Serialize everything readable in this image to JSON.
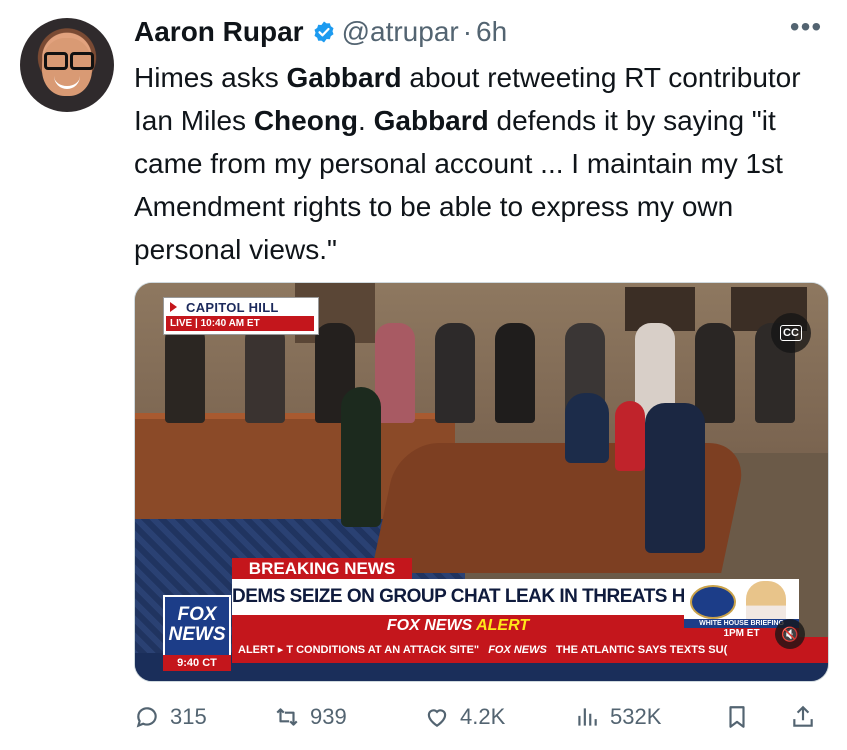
{
  "author": {
    "name": "Aaron Rupar",
    "handle": "@atrupar",
    "separator": "·",
    "time": "6h",
    "verified": true
  },
  "menu_icon": "more-dots-icon",
  "tweet": {
    "parts": [
      {
        "text": "Himes asks ",
        "bold": false
      },
      {
        "text": "Gabbard",
        "bold": true
      },
      {
        "text": " about retweeting RT contributor Ian Miles ",
        "bold": false
      },
      {
        "text": "Cheong",
        "bold": true
      },
      {
        "text": ". ",
        "bold": false
      },
      {
        "text": "Gabbard",
        "bold": true
      },
      {
        "text": " defends it by saying \"it came from my personal account ... I maintain my 1st Amendment rights to be able to express my own personal views.\"",
        "bold": false
      }
    ]
  },
  "video": {
    "location_title": "CAPITOL HILL",
    "live_text": "LIVE | 10:40 AM ET",
    "cc_label": "CC",
    "breaking_label": "BREAKING NEWS",
    "headline": "DEMS SEIZE ON GROUP CHAT LEAK IN THREATS HEARING",
    "alert_brand": "FOX NEWS",
    "alert_word": "ALERT",
    "ticker_prefix": "ALERT",
    "ticker_text": "T CONDITIONS AT AN ATTACK SITE\"",
    "ticker_brand": "FOX NEWS",
    "ticker_text2": "THE ATLANTIC SAYS TEXTS SU(",
    "network_logo_line1": "FOX",
    "network_logo_line2": "NEWS",
    "network_time": "9:40 CT",
    "inset_label": "WHITE HOUSE BRIEFING",
    "inset_time": "1PM ET",
    "mute_icon": "speaker-muted-icon"
  },
  "actions": {
    "replies": "315",
    "reposts": "939",
    "likes": "4.2K",
    "views": "532K"
  },
  "colors": {
    "text": "#0f1419",
    "muted": "#536471",
    "verified": "#1d9bf0",
    "fox_red": "#c4161c",
    "fox_blue": "#1c3d88"
  }
}
